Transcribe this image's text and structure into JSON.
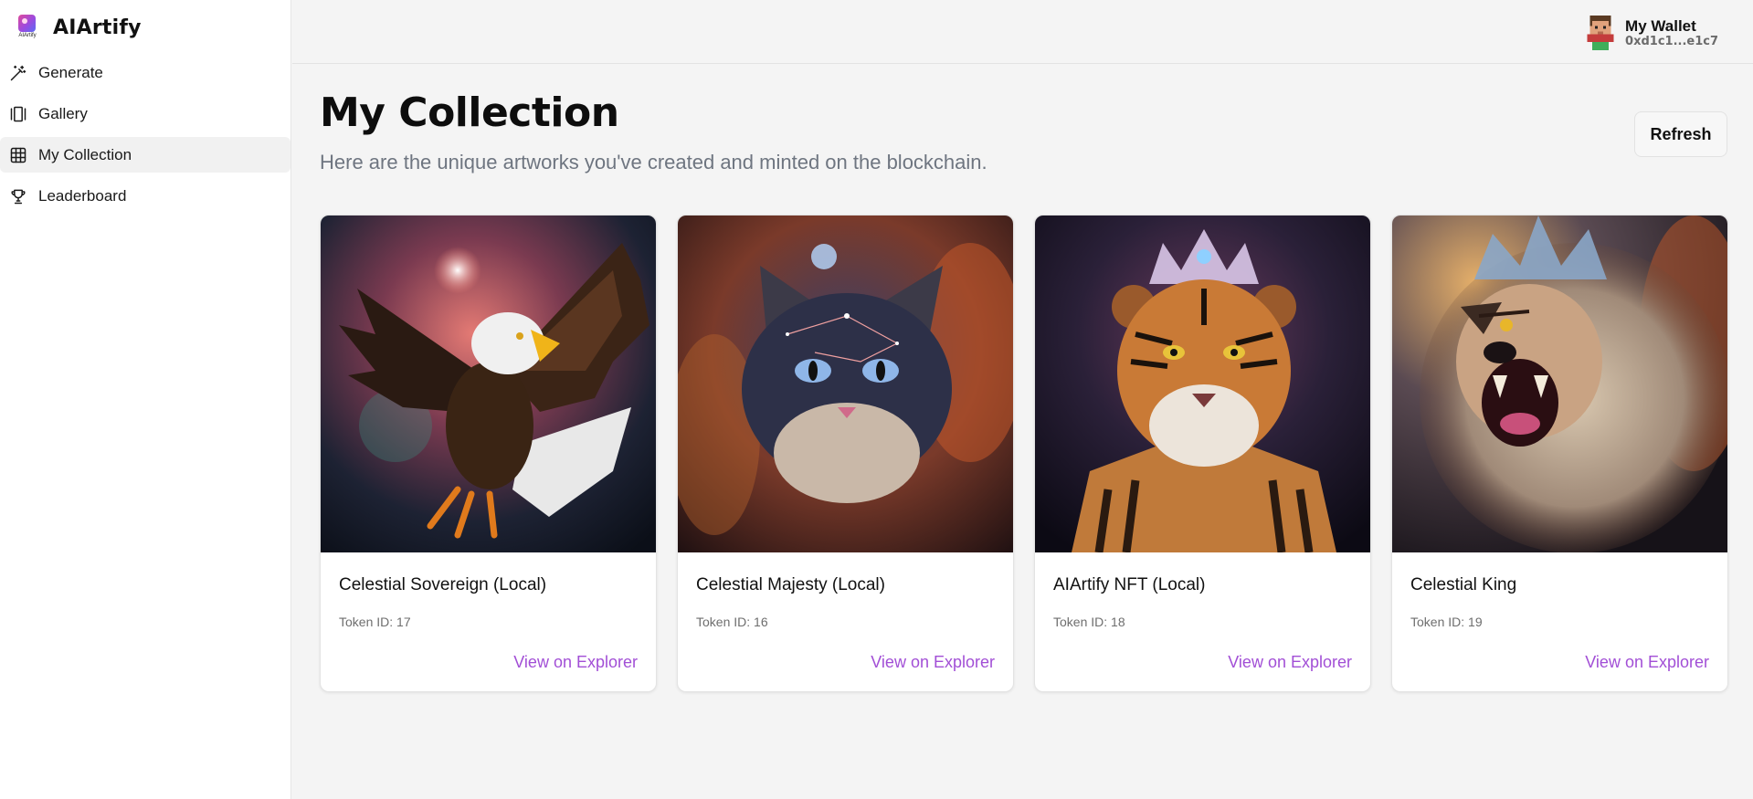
{
  "app": {
    "name": "AIArtify",
    "logo_caption": "AIArtify"
  },
  "sidebar": {
    "items": [
      {
        "label": "Generate",
        "icon": "magic-wand-icon",
        "active": false
      },
      {
        "label": "Gallery",
        "icon": "gallery-icon",
        "active": false
      },
      {
        "label": "My Collection",
        "icon": "grid-icon",
        "active": true
      },
      {
        "label": "Leaderboard",
        "icon": "trophy-icon",
        "active": false
      }
    ]
  },
  "header": {
    "wallet_title": "My Wallet",
    "wallet_address": "0xd1c1...e1c7"
  },
  "main": {
    "title": "My Collection",
    "subtitle": "Here are the unique artworks you've created and minted on the blockchain.",
    "refresh_label": "Refresh",
    "cards": [
      {
        "title": "Celestial Sovereign (Local)",
        "token": "Token ID: 17",
        "link": "View on Explorer",
        "art": "cosmic eagle"
      },
      {
        "title": "Celestial Majesty (Local)",
        "token": "Token ID: 16",
        "link": "View on Explorer",
        "art": "cosmic cat"
      },
      {
        "title": "AIArtify NFT (Local)",
        "token": "Token ID: 18",
        "link": "View on Explorer",
        "art": "crowned tiger"
      },
      {
        "title": "Celestial King",
        "token": "Token ID: 19",
        "link": "View on Explorer",
        "art": "crowned lion"
      }
    ]
  },
  "colors": {
    "accent": "#a24fd6",
    "background": "#f4f4f4",
    "sidebar": "#ffffff",
    "muted_text": "#6e7580"
  }
}
